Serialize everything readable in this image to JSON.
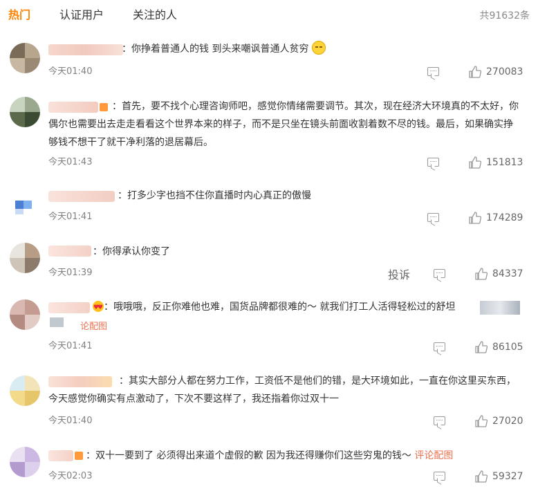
{
  "tabs": [
    {
      "label": "热门",
      "active": true
    },
    {
      "label": "认证用户",
      "active": false
    },
    {
      "label": "关注的人",
      "active": false
    }
  ],
  "total_count": "共91632条",
  "colors": {
    "accent": "#ff8200",
    "link": "#eb7350",
    "muted": "#808080"
  },
  "comments": [
    {
      "text": "：你挣着普通人的钱 到头来嘲讽普通人贫穷",
      "emoji": "face-emoji",
      "time": "今天01:40",
      "likes": "270083",
      "report": ""
    },
    {
      "text": "：首先，要不找个心理咨询师吧，感觉你情绪需要调节。其次，现在经济大环境真的不太好，你偶尔也需要出去走走看看这个世界本来的样子，而不是只坐在镜头前面收割着数不尽的钱。最后，如果确实挣够钱不想干了就干净利落的退居幕后。",
      "time": "今天01:43",
      "likes": "151813",
      "report": ""
    },
    {
      "text": "：打多少字也挡不住你直播时内心真正的傲慢",
      "time": "今天01:41",
      "likes": "174289",
      "report": ""
    },
    {
      "text": "：你得承认你变了",
      "time": "今天01:39",
      "likes": "84337",
      "report": "投诉"
    },
    {
      "text": "：哦哦哦，反正你难他也难，国货品牌都很难的～ 就我们打工人活得轻松过的舒坦",
      "link": "论配图",
      "time": "今天01:41",
      "likes": "86105",
      "report": ""
    },
    {
      "text": "：其实大部分人都在努力工作，工资低不是他们的错，是大环境如此，一直在你这里买东西，今天感觉你确实有点激动了，下次不要这样了，我还指着你过双十一",
      "time": "今天01:40",
      "likes": "27020",
      "report": ""
    },
    {
      "text": "：双十一要到了 必须得出来道个虚假的歉 因为我还得赚你们这些穷鬼的钱～ ",
      "link": "评论配图",
      "time": "今天02:03",
      "likes": "59327",
      "report": ""
    }
  ]
}
